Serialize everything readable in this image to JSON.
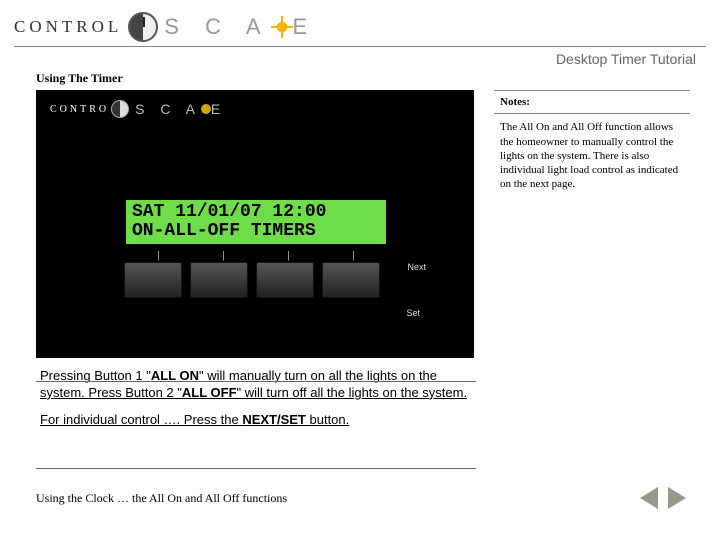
{
  "header": {
    "logo_left": "CONTROL",
    "logo_right_pre": "S C A",
    "logo_right_post": "E",
    "subtitle": "Desktop Timer Tutorial"
  },
  "section_title": "Using The Timer",
  "device": {
    "logo_left": "CONTRO",
    "logo_right_pre": "S C A",
    "logo_right_post": "E",
    "lcd_line1": "SAT  11/01/07  12:00",
    "lcd_line2": "ON-ALL-OFF    TIMERS",
    "label_next": "Next",
    "label_set": "Set"
  },
  "notes": {
    "title": "Notes:",
    "body": "The All On and All Off function allows the homeowner to manually control the lights on the system. There is also individual light load control as indicated on the next page."
  },
  "instructions": {
    "p1_a": "Pressing Button 1 \"",
    "p1_b": "ALL ON",
    "p1_c": "\" will manually turn on all the lights on the system. Press Button 2 \"",
    "p1_d": "ALL OFF",
    "p1_e": "\" will turn off all the lights on the system.",
    "p2_a": "For individual control …. Press the ",
    "p2_b": "NEXT/SET",
    "p2_c": " button."
  },
  "footer": {
    "caption": "Using the Clock … the All On and All Off functions"
  }
}
